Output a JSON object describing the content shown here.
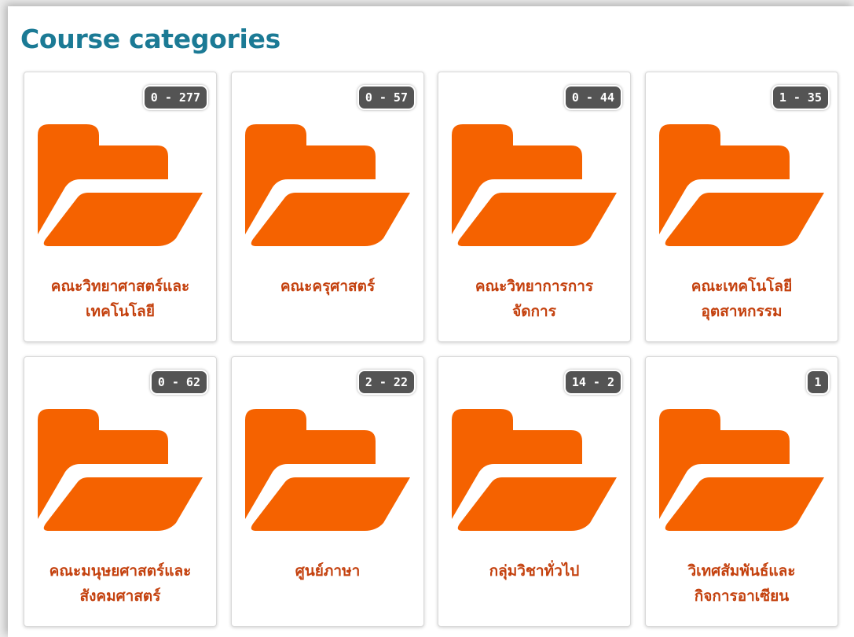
{
  "page": {
    "title": "Course categories"
  },
  "colors": {
    "title": "#1b7a95",
    "folder": "#f56200",
    "category_text": "#c4410e",
    "badge_bg": "#545454"
  },
  "categories": [
    {
      "name_line1": "คณะวิทยาศาสตร์และ",
      "name_line2": "เทคโนโลยี",
      "badge": "0 - 277",
      "icon": "folder-open-icon"
    },
    {
      "name_line1": "คณะครุศาสตร์",
      "name_line2": "",
      "badge": "0 - 57",
      "icon": "folder-open-icon"
    },
    {
      "name_line1": "คณะวิทยาการการ",
      "name_line2": "จัดการ",
      "badge": "0 - 44",
      "icon": "folder-open-icon"
    },
    {
      "name_line1": "คณะเทคโนโลยี",
      "name_line2": "อุตสาหกรรม",
      "badge": "1 - 35",
      "icon": "folder-open-icon"
    },
    {
      "name_line1": "คณะมนุษยศาสตร์และ",
      "name_line2": "สังคมศาสตร์",
      "badge": "0 - 62",
      "icon": "folder-open-icon"
    },
    {
      "name_line1": "ศูนย์ภาษา",
      "name_line2": "",
      "badge": "2 - 22",
      "icon": "folder-open-icon"
    },
    {
      "name_line1": "กลุ่มวิชาทั่วไป",
      "name_line2": "",
      "badge": "14 - 2",
      "icon": "folder-open-icon"
    },
    {
      "name_line1": "วิเทศสัมพันธ์และ",
      "name_line2": "กิจการอาเซียน",
      "badge": "1",
      "icon": "folder-open-icon"
    }
  ]
}
